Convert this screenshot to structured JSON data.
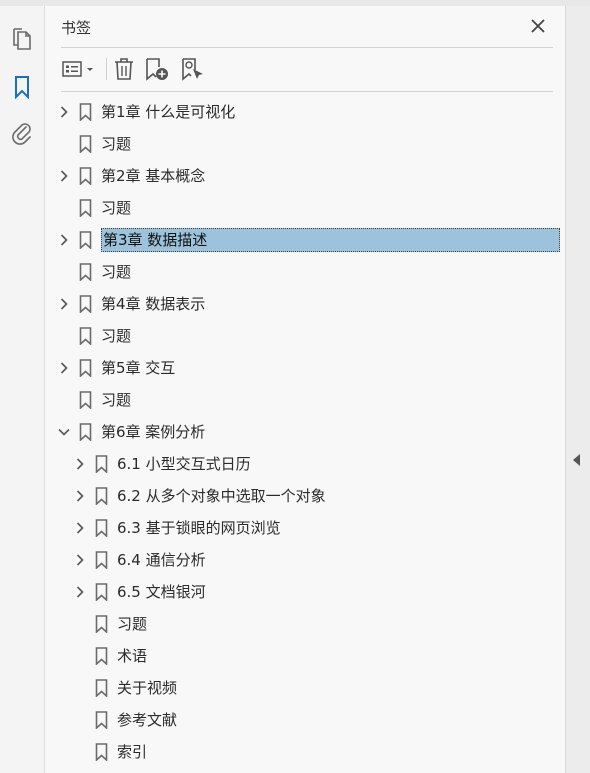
{
  "panel": {
    "title": "书签"
  },
  "colors": {
    "selection": "#9dc3dc",
    "accent": "#1a6fc2",
    "icon": "#6b6b6b"
  },
  "left_rail": {
    "icons": [
      "pages-icon",
      "bookmark-icon",
      "attachment-icon"
    ],
    "active": "bookmark-icon"
  },
  "toolbar": {
    "icons": [
      "options-menu-icon",
      "delete-bookmark-icon",
      "new-bookmark-icon",
      "find-bookmark-icon"
    ]
  },
  "bookmarks": [
    {
      "label": "第1章 什么是可视化",
      "level": 0,
      "expandable": true,
      "expanded": false
    },
    {
      "label": "习题",
      "level": 0,
      "expandable": false
    },
    {
      "label": "第2章 基本概念",
      "level": 0,
      "expandable": true,
      "expanded": false
    },
    {
      "label": "习题",
      "level": 0,
      "expandable": false
    },
    {
      "label": "第3章 数据描述",
      "level": 0,
      "expandable": true,
      "expanded": false,
      "selected": true
    },
    {
      "label": "习题",
      "level": 0,
      "expandable": false
    },
    {
      "label": "第4章 数据表示",
      "level": 0,
      "expandable": true,
      "expanded": false
    },
    {
      "label": "习题",
      "level": 0,
      "expandable": false
    },
    {
      "label": "第5章 交互",
      "level": 0,
      "expandable": true,
      "expanded": false
    },
    {
      "label": "习题",
      "level": 0,
      "expandable": false
    },
    {
      "label": "第6章 案例分析",
      "level": 0,
      "expandable": true,
      "expanded": true
    },
    {
      "label": "6.1 小型交互式日历",
      "level": 1,
      "expandable": true,
      "expanded": false
    },
    {
      "label": "6.2 从多个对象中选取一个对象",
      "level": 1,
      "expandable": true,
      "expanded": false
    },
    {
      "label": "6.3 基于锁眼的网页浏览",
      "level": 1,
      "expandable": true,
      "expanded": false
    },
    {
      "label": "6.4 通信分析",
      "level": 1,
      "expandable": true,
      "expanded": false
    },
    {
      "label": "6.5 文档银河",
      "level": 1,
      "expandable": true,
      "expanded": false
    },
    {
      "label": "习题",
      "level": 1,
      "expandable": false
    },
    {
      "label": "术语",
      "level": 1,
      "expandable": false
    },
    {
      "label": "关于视频",
      "level": 1,
      "expandable": false
    },
    {
      "label": "参考文献",
      "level": 1,
      "expandable": false
    },
    {
      "label": "索引",
      "level": 1,
      "expandable": false
    }
  ]
}
